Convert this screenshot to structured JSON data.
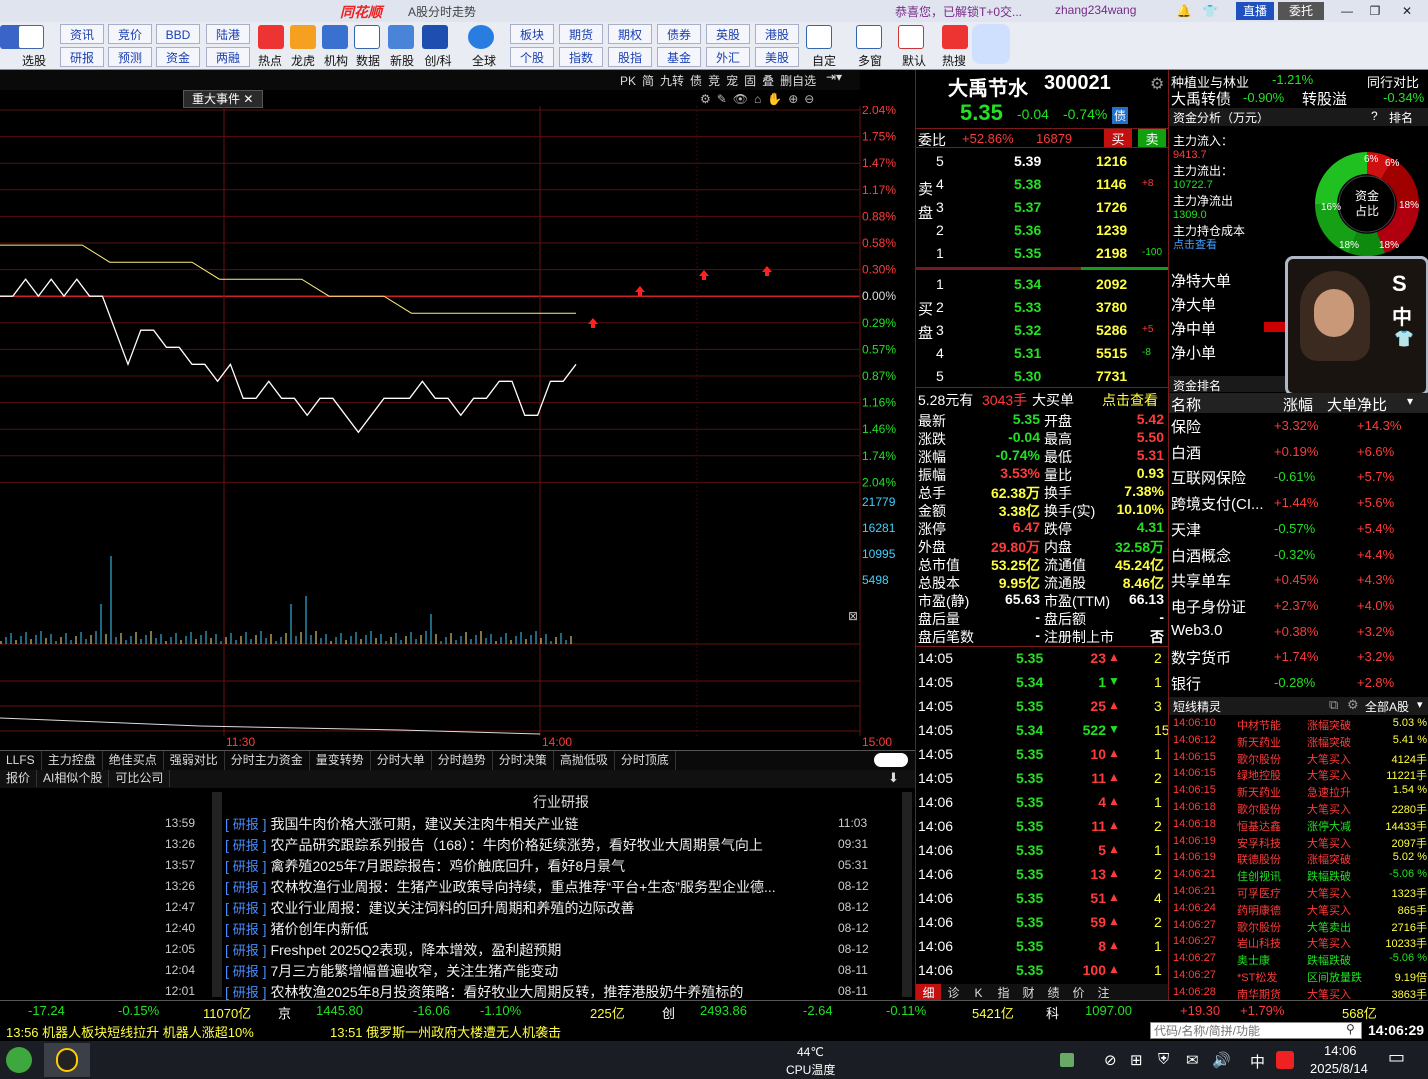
{
  "window": {
    "logo": "同花顺",
    "title": "A股分时走势",
    "message": "恭喜您，已解锁T+0交...",
    "user": "zhang234wang",
    "live_btn": "直播",
    "delegate_btn": "委托"
  },
  "toolbar": {
    "row1": [
      "资讯",
      "竞价",
      "BBD",
      "陆港",
      "板块",
      "期货",
      "期权",
      "债券",
      "英股",
      "港股"
    ],
    "row2": [
      "研报",
      "预测",
      "资金",
      "两融",
      "个股",
      "指数",
      "股指",
      "基金",
      "外汇",
      "美股"
    ],
    "labels": [
      "选股",
      "热点",
      "龙虎",
      "机构",
      "数据",
      "新股",
      "创/科",
      "全球",
      "自定",
      "多窗",
      "默认",
      "热搜"
    ]
  },
  "chart": {
    "top_tools": [
      "PK",
      "简",
      "九转",
      "债",
      "竞",
      "宠",
      "固",
      "叠",
      "删自选"
    ],
    "event_tab": "重大事件",
    "pct_labels": [
      "2.04%",
      "1.75%",
      "1.47%",
      "1.17%",
      "0.88%",
      "0.58%",
      "0.30%",
      "0.00%",
      "0.29%",
      "0.57%",
      "0.87%",
      "1.16%",
      "1.46%",
      "1.74%",
      "2.04%"
    ],
    "vol_labels": [
      "21779",
      "16281",
      "10995",
      "5498"
    ],
    "time_labels": [
      "11:30",
      "14:00",
      "15:00"
    ],
    "series_price": [
      5.39,
      5.39,
      5.4,
      5.39,
      5.4,
      5.39,
      5.4,
      5.39,
      5.39,
      5.37,
      5.35,
      5.37,
      5.37,
      5.36,
      5.36,
      5.35,
      5.35,
      5.34,
      5.35,
      5.33,
      5.33,
      5.34,
      5.33,
      5.33,
      5.32,
      5.33,
      5.33,
      5.32,
      5.31,
      5.32,
      5.33,
      5.33,
      5.33,
      5.34,
      5.33,
      5.33,
      5.32,
      5.33,
      5.33,
      5.34,
      5.34,
      5.32,
      5.32,
      5.34,
      5.34,
      5.35
    ],
    "series_avg": [
      5.42,
      5.42,
      5.42,
      5.42,
      5.41,
      5.41,
      5.41,
      5.41,
      5.4,
      5.4,
      5.4,
      5.4,
      5.39,
      5.39,
      5.39,
      5.38,
      5.38,
      5.38,
      5.38,
      5.38,
      5.38,
      5.38
    ]
  },
  "tabs_bottom": [
    "LLFS",
    "主力控盘",
    "绝佳买点",
    "强弱对比",
    "分时主力资金",
    "量变转势",
    "分时大单",
    "分时趋势",
    "分时决策",
    "高抛低吸",
    "分时顶底"
  ],
  "tabs_bottom2": [
    "报价",
    "AI相似个股",
    "可比公司"
  ],
  "news": {
    "header": "行业研报",
    "left_times": [
      "13:59",
      "13:26",
      "13:57",
      "13:26",
      "12:47",
      "12:40",
      "12:05",
      "12:04",
      "12:01"
    ],
    "items": [
      {
        "tag": "研报",
        "title": "我国牛肉价格大涨可期，建议关注肉牛相关产业链",
        "date": "11:03"
      },
      {
        "tag": "研报",
        "title": "农产品研究跟踪系列报告（168）：牛肉价格延续涨势，看好牧业大周期景气向上",
        "date": "09:31"
      },
      {
        "tag": "研报",
        "title": "禽养殖2025年7月跟踪报告：鸡价触底回升，看好8月景气",
        "date": "05:31"
      },
      {
        "tag": "研报",
        "title": "农林牧渔行业周报：生猪产业政策导向持续，重点推荐“平台+生态”服务型企业德...",
        "date": "08-12"
      },
      {
        "tag": "研报",
        "title": "农业行业周报：建议关注饲料的回升周期和养殖的边际改善",
        "date": "08-12"
      },
      {
        "tag": "研报",
        "title": "猪价创年内新低",
        "date": "08-12"
      },
      {
        "tag": "研报",
        "title": "Freshpet 2025Q2表现，降本增效，盈利超预期",
        "date": "08-12"
      },
      {
        "tag": "研报",
        "title": "7月三方能繁增幅普遍收窄，关注生猪产能变动",
        "date": "08-11"
      },
      {
        "tag": "研报",
        "title": "农林牧渔2025年8月投资策略：看好牧业大周期反转，推荐港股奶牛养殖标的",
        "date": "08-11"
      }
    ]
  },
  "quote": {
    "name": "大禹节水",
    "code": "300021",
    "price": "5.35",
    "change": "-0.04",
    "pct": "-0.74%",
    "bond_badge": "债",
    "weibi_label": "委比",
    "weibi": "+52.86%",
    "weicha": "16879",
    "buy": "买",
    "sell": "卖",
    "sell_side": "卖盘",
    "buy_side": "买盘",
    "asks": [
      {
        "n": "5",
        "p": "5.39",
        "v": "1216",
        "d": ""
      },
      {
        "n": "4",
        "p": "5.38",
        "v": "1146",
        "d": "+8"
      },
      {
        "n": "3",
        "p": "5.37",
        "v": "1726",
        "d": ""
      },
      {
        "n": "2",
        "p": "5.36",
        "v": "1239",
        "d": ""
      },
      {
        "n": "1",
        "p": "5.35",
        "v": "2198",
        "d": "-100"
      }
    ],
    "bids": [
      {
        "n": "1",
        "p": "5.34",
        "v": "2092",
        "d": ""
      },
      {
        "n": "2",
        "p": "5.33",
        "v": "3780",
        "d": ""
      },
      {
        "n": "3",
        "p": "5.32",
        "v": "5286",
        "d": "+5"
      },
      {
        "n": "4",
        "p": "5.31",
        "v": "5515",
        "d": "-8"
      },
      {
        "n": "5",
        "p": "5.30",
        "v": "7731",
        "d": ""
      }
    ],
    "big_order": {
      "price": "5.28元有",
      "vol": "3043手",
      "label": "大买单",
      "link": "点击查看"
    },
    "fields": [
      [
        "最新",
        "5.35",
        "开盘",
        "5.42"
      ],
      [
        "涨跌",
        "-0.04",
        "最高",
        "5.50"
      ],
      [
        "涨幅",
        "-0.74%",
        "最低",
        "5.31"
      ],
      [
        "振幅",
        "3.53%",
        "量比",
        "0.93"
      ],
      [
        "总手",
        "62.38万",
        "换手",
        "7.38%"
      ],
      [
        "金额",
        "3.38亿",
        "换手(实)",
        "10.10%"
      ],
      [
        "涨停",
        "6.47",
        "跌停",
        "4.31"
      ],
      [
        "外盘",
        "29.80万",
        "内盘",
        "32.58万"
      ],
      [
        "总市值",
        "53.25亿",
        "流通值",
        "45.24亿"
      ],
      [
        "总股本",
        "9.95亿",
        "流通股",
        "8.46亿"
      ],
      [
        "市盈(静)",
        "65.63",
        "市盈(TTM)",
        "66.13"
      ],
      [
        "盘后量",
        "-",
        "盘后额",
        "-"
      ],
      [
        "盘后笔数",
        "-",
        "注册制上市",
        "否"
      ]
    ],
    "ticks": [
      {
        "t": "14:05",
        "p": "5.35",
        "v": "23",
        "d": "up",
        "n": "2"
      },
      {
        "t": "14:05",
        "p": "5.34",
        "v": "1",
        "d": "down",
        "n": "1"
      },
      {
        "t": "14:05",
        "p": "5.35",
        "v": "25",
        "d": "up",
        "n": "3"
      },
      {
        "t": "14:05",
        "p": "5.34",
        "v": "522",
        "d": "down",
        "n": "15"
      },
      {
        "t": "14:05",
        "p": "5.35",
        "v": "10",
        "d": "up",
        "n": "1"
      },
      {
        "t": "14:05",
        "p": "5.35",
        "v": "11",
        "d": "up",
        "n": "2"
      },
      {
        "t": "14:06",
        "p": "5.35",
        "v": "4",
        "d": "up",
        "n": "1"
      },
      {
        "t": "14:06",
        "p": "5.35",
        "v": "11",
        "d": "up",
        "n": "2"
      },
      {
        "t": "14:06",
        "p": "5.35",
        "v": "5",
        "d": "up",
        "n": "1"
      },
      {
        "t": "14:06",
        "p": "5.35",
        "v": "13",
        "d": "up",
        "n": "2"
      },
      {
        "t": "14:06",
        "p": "5.35",
        "v": "51",
        "d": "up",
        "n": "4"
      },
      {
        "t": "14:06",
        "p": "5.35",
        "v": "59",
        "d": "up",
        "n": "2"
      },
      {
        "t": "14:06",
        "p": "5.35",
        "v": "8",
        "d": "up",
        "n": "1"
      },
      {
        "t": "14:06",
        "p": "5.35",
        "v": "100",
        "d": "up",
        "n": "1"
      }
    ],
    "bottom_tabs": [
      "细",
      "诊",
      "K",
      "指",
      "财",
      "绩",
      "价",
      "注"
    ]
  },
  "side": {
    "industry": {
      "name": "种植业与林业",
      "pct": "-1.21%",
      "peer": "同行对比"
    },
    "bond": {
      "name": "大禹转债",
      "pct": "-0.90%",
      "extra": "转股溢",
      "extra_pct": "-0.34%"
    },
    "fund_title": "资金分析（万元）",
    "help": "?",
    "rank_label": "排名",
    "fund_items": [
      {
        "k": "主力流入：",
        "v": "9413.7"
      },
      {
        "k": "主力流出：",
        "v": "10722.7"
      },
      {
        "k": "主力净流出",
        "v": "1309.0"
      },
      {
        "k": "主力持仓成本",
        "v": "点击查看"
      }
    ],
    "donut": {
      "center1": "资金",
      "center2": "占比",
      "slices": [
        "6%",
        "6%",
        "18%",
        "18%",
        "18%",
        "16%"
      ]
    },
    "net_items": [
      "净特大单",
      "净大单",
      "净中单",
      "净小单"
    ],
    "video_char": "中",
    "rank_title": "资金排名",
    "rank_cols": [
      "名称",
      "涨幅",
      "大单净比"
    ],
    "ranks": [
      {
        "n": "保险",
        "p": "+3.32%",
        "v": "+14.3%"
      },
      {
        "n": "白酒",
        "p": "+0.19%",
        "v": "+6.6%"
      },
      {
        "n": "互联网保险",
        "p": "-0.61%",
        "v": "+5.7%"
      },
      {
        "n": "跨境支付(CI...",
        "p": "+1.44%",
        "v": "+5.6%"
      },
      {
        "n": "天津",
        "p": "-0.57%",
        "v": "+5.4%"
      },
      {
        "n": "白酒概念",
        "p": "-0.32%",
        "v": "+4.4%"
      },
      {
        "n": "共享单车",
        "p": "+0.45%",
        "v": "+4.3%"
      },
      {
        "n": "电子身份证",
        "p": "+2.37%",
        "v": "+4.0%"
      },
      {
        "n": "Web3.0",
        "p": "+0.38%",
        "v": "+3.2%"
      },
      {
        "n": "数字货币",
        "p": "+1.74%",
        "v": "+3.2%"
      },
      {
        "n": "银行",
        "p": "-0.28%",
        "v": "+2.8%"
      }
    ],
    "wizard_title": "短线精灵",
    "wizard_scope": "全部A股",
    "wizard": [
      {
        "t": "14:06:10",
        "n": "中材节能",
        "e": "涨幅突破",
        "v": "5.03 %"
      },
      {
        "t": "14:06:12",
        "n": "新天药业",
        "e": "涨幅突破",
        "v": "5.41 %"
      },
      {
        "t": "14:06:15",
        "n": "歌尔股份",
        "e": "大笔买入",
        "v": "4124手"
      },
      {
        "t": "14:06:15",
        "n": "绿地控股",
        "e": "大笔买入",
        "v": "11221手"
      },
      {
        "t": "14:06:15",
        "n": "新天药业",
        "e": "急速拉升",
        "v": "1.54 %"
      },
      {
        "t": "14:06:18",
        "n": "歌尔股份",
        "e": "大笔买入",
        "v": "2280手"
      },
      {
        "t": "14:06:18",
        "n": "恒基达鑫",
        "e": "涨停大减",
        "v": "14433手"
      },
      {
        "t": "14:06:19",
        "n": "安孚科技",
        "e": "大笔买入",
        "v": "2097手"
      },
      {
        "t": "14:06:19",
        "n": "联德股份",
        "e": "涨幅突破",
        "v": "5.02 %"
      },
      {
        "t": "14:06:21",
        "n": "佳创视讯",
        "e": "跌幅跌破",
        "v": "-5.06 %"
      },
      {
        "t": "14:06:21",
        "n": "可孚医疗",
        "e": "大笔买入",
        "v": "1323手"
      },
      {
        "t": "14:06:24",
        "n": "药明康德",
        "e": "大笔买入",
        "v": "865手"
      },
      {
        "t": "14:06:27",
        "n": "歌尔股份",
        "e": "大笔卖出",
        "v": "2716手"
      },
      {
        "t": "14:06:27",
        "n": "岩山科技",
        "e": "大笔买入",
        "v": "10233手"
      },
      {
        "t": "14:06:27",
        "n": "奥士康",
        "e": "跌幅跌破",
        "v": "-5.06 %"
      },
      {
        "t": "14:06:27",
        "n": "*ST松发",
        "e": "区间放量跌",
        "v": "9.19倍"
      },
      {
        "t": "14:06:28",
        "n": "南华期货",
        "e": "大笔买入",
        "v": "3863手"
      }
    ]
  },
  "status": {
    "items": [
      "-17.24",
      "-0.15%",
      "11070亿",
      "京",
      "1445.80",
      "-16.06",
      "-1.10%",
      "225亿",
      "创",
      "2493.86",
      "-2.64",
      "-0.11%",
      "5421亿",
      "科",
      "1097.00",
      "+19.30",
      "+1.79%",
      "568亿"
    ]
  },
  "ticker": {
    "left": "13:56 机器人板块短线拉升 机器人涨超10%",
    "right": "13:51 俄罗斯一州政府大楼遭无人机袭击",
    "search_placeholder": "代码/名称/简拼/功能",
    "clock": "14:06:29"
  },
  "taskbar": {
    "temp": "44℃",
    "temp_label": "CPU温度",
    "ime": "中",
    "time": "14:06",
    "date": "2025/8/14"
  }
}
